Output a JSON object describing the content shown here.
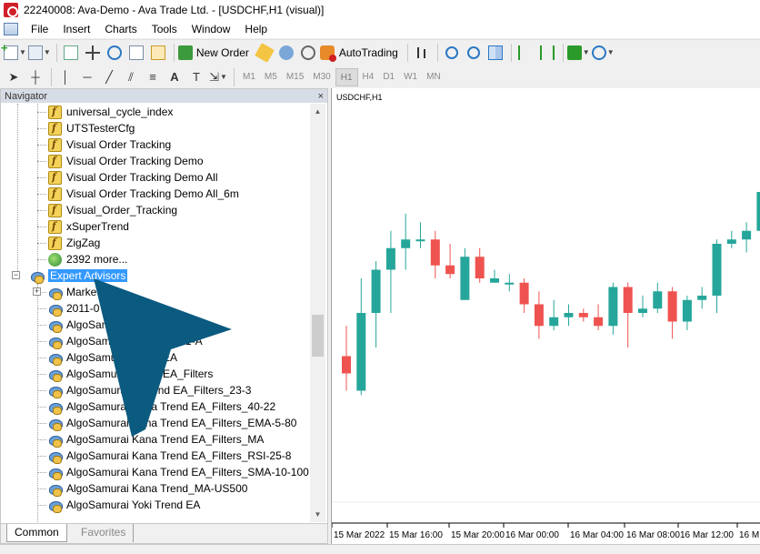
{
  "window": {
    "title": "22240008: Ava-Demo - Ava Trade Ltd. - [USDCHF,H1 (visual)]"
  },
  "menu": {
    "items": [
      "File",
      "Insert",
      "Charts",
      "Tools",
      "Window",
      "Help"
    ]
  },
  "toolbar": {
    "new_order_label": "New Order",
    "autotrading_label": "AutoTrading"
  },
  "timeframes": {
    "items": [
      "M1",
      "M5",
      "M15",
      "M30",
      "H1",
      "H4",
      "D1",
      "W1",
      "MN"
    ],
    "active": "H1"
  },
  "navigator": {
    "title": "Navigator",
    "close": "×",
    "indicators": [
      "universal_cycle_index",
      "UTSTesterCfg",
      "Visual Order Tracking",
      "Visual Order Tracking Demo",
      "Visual Order Tracking Demo All",
      "Visual Order Tracking Demo All_6m",
      "Visual_Order_Tracking",
      "xSuperTrend",
      "ZigZag"
    ],
    "more_label": "2392 more...",
    "expert_advisors_label": "Expert Advisors",
    "expert_advisors": [
      "Marke",
      "2011-0                      1.3",
      "AlgoSam                       _500_1",
      "AlgoSamurai          GBPJPY-H1-A",
      "AlgoSamurai         Trend EA",
      "AlgoSamurai        Trend EA_Filters",
      "AlgoSamurai K      Trend EA_Filters_23-3",
      "AlgoSamurai Kana Trend EA_Filters_40-22",
      "AlgoSamurai Kana Trend EA_Filters_EMA-5-80",
      "AlgoSamurai Kana Trend EA_Filters_MA",
      "AlgoSamurai Kana Trend EA_Filters_RSI-25-8",
      "AlgoSamurai Kana Trend EA_Filters_SMA-10-100",
      "AlgoSamurai Kana Trend_MA-US500",
      "AlgoSamurai Yoki Trend EA"
    ],
    "tabs": {
      "common": "Common",
      "favorites": "Favorites"
    }
  },
  "chart": {
    "symbol_label": "USDCHF,H1",
    "time_labels": [
      "15 Mar 2022",
      "15 Mar 16:00",
      "15 Mar 20:00",
      "16 Mar 00:00",
      "16 Mar 04:00",
      "16 Mar 08:00",
      "16 Mar 12:00",
      "16 M"
    ]
  },
  "colors": {
    "bull_candle": "#26a69a",
    "bear_candle": "#ef5350",
    "selection": "#3399ff",
    "overlay_arrow": "#0b5a80"
  },
  "chart_data": {
    "type": "candlestick",
    "symbol": "USDCHF",
    "timeframe": "H1",
    "candles": [
      {
        "o": 0.62,
        "h": 0.55,
        "l": 0.7,
        "c": 0.66,
        "dir": "bear"
      },
      {
        "o": 0.7,
        "h": 0.44,
        "l": 0.71,
        "c": 0.52,
        "dir": "bull"
      },
      {
        "o": 0.52,
        "h": 0.4,
        "l": 0.6,
        "c": 0.42,
        "dir": "bull"
      },
      {
        "o": 0.42,
        "h": 0.33,
        "l": 0.52,
        "c": 0.37,
        "dir": "bull"
      },
      {
        "o": 0.37,
        "h": 0.29,
        "l": 0.42,
        "c": 0.35,
        "dir": "bull"
      },
      {
        "o": 0.35,
        "h": 0.31,
        "l": 0.37,
        "c": 0.35,
        "dir": "bull"
      },
      {
        "o": 0.35,
        "h": 0.33,
        "l": 0.44,
        "c": 0.41,
        "dir": "bear"
      },
      {
        "o": 0.41,
        "h": 0.36,
        "l": 0.44,
        "c": 0.43,
        "dir": "bear"
      },
      {
        "o": 0.49,
        "h": 0.37,
        "l": 0.49,
        "c": 0.39,
        "dir": "bull"
      },
      {
        "o": 0.39,
        "h": 0.37,
        "l": 0.45,
        "c": 0.44,
        "dir": "bear"
      },
      {
        "o": 0.44,
        "h": 0.42,
        "l": 0.45,
        "c": 0.45,
        "dir": "bull"
      },
      {
        "o": 0.45,
        "h": 0.43,
        "l": 0.47,
        "c": 0.45,
        "dir": "bull"
      },
      {
        "o": 0.45,
        "h": 0.44,
        "l": 0.52,
        "c": 0.5,
        "dir": "bear"
      },
      {
        "o": 0.5,
        "h": 0.47,
        "l": 0.58,
        "c": 0.55,
        "dir": "bear"
      },
      {
        "o": 0.55,
        "h": 0.49,
        "l": 0.56,
        "c": 0.53,
        "dir": "bull"
      },
      {
        "o": 0.53,
        "h": 0.5,
        "l": 0.55,
        "c": 0.52,
        "dir": "bull"
      },
      {
        "o": 0.52,
        "h": 0.51,
        "l": 0.54,
        "c": 0.53,
        "dir": "bear"
      },
      {
        "o": 0.53,
        "h": 0.5,
        "l": 0.56,
        "c": 0.55,
        "dir": "bear"
      },
      {
        "o": 0.55,
        "h": 0.45,
        "l": 0.57,
        "c": 0.46,
        "dir": "bull"
      },
      {
        "o": 0.46,
        "h": 0.45,
        "l": 0.6,
        "c": 0.52,
        "dir": "bear"
      },
      {
        "o": 0.52,
        "h": 0.48,
        "l": 0.53,
        "c": 0.51,
        "dir": "bull"
      },
      {
        "o": 0.51,
        "h": 0.45,
        "l": 0.52,
        "c": 0.47,
        "dir": "bull"
      },
      {
        "o": 0.47,
        "h": 0.46,
        "l": 0.58,
        "c": 0.54,
        "dir": "bear"
      },
      {
        "o": 0.54,
        "h": 0.48,
        "l": 0.56,
        "c": 0.49,
        "dir": "bull"
      },
      {
        "o": 0.49,
        "h": 0.46,
        "l": 0.51,
        "c": 0.48,
        "dir": "bull"
      },
      {
        "o": 0.48,
        "h": 0.35,
        "l": 0.52,
        "c": 0.36,
        "dir": "bull"
      },
      {
        "o": 0.36,
        "h": 0.33,
        "l": 0.37,
        "c": 0.35,
        "dir": "bull"
      },
      {
        "o": 0.35,
        "h": 0.31,
        "l": 0.38,
        "c": 0.33,
        "dir": "bull"
      },
      {
        "o": 0.33,
        "h": 0.22,
        "l": 0.34,
        "c": 0.24,
        "dir": "bull"
      },
      {
        "o": 0.24,
        "h": 0.17,
        "l": 0.25,
        "c": 0.22,
        "dir": "bull"
      }
    ]
  }
}
